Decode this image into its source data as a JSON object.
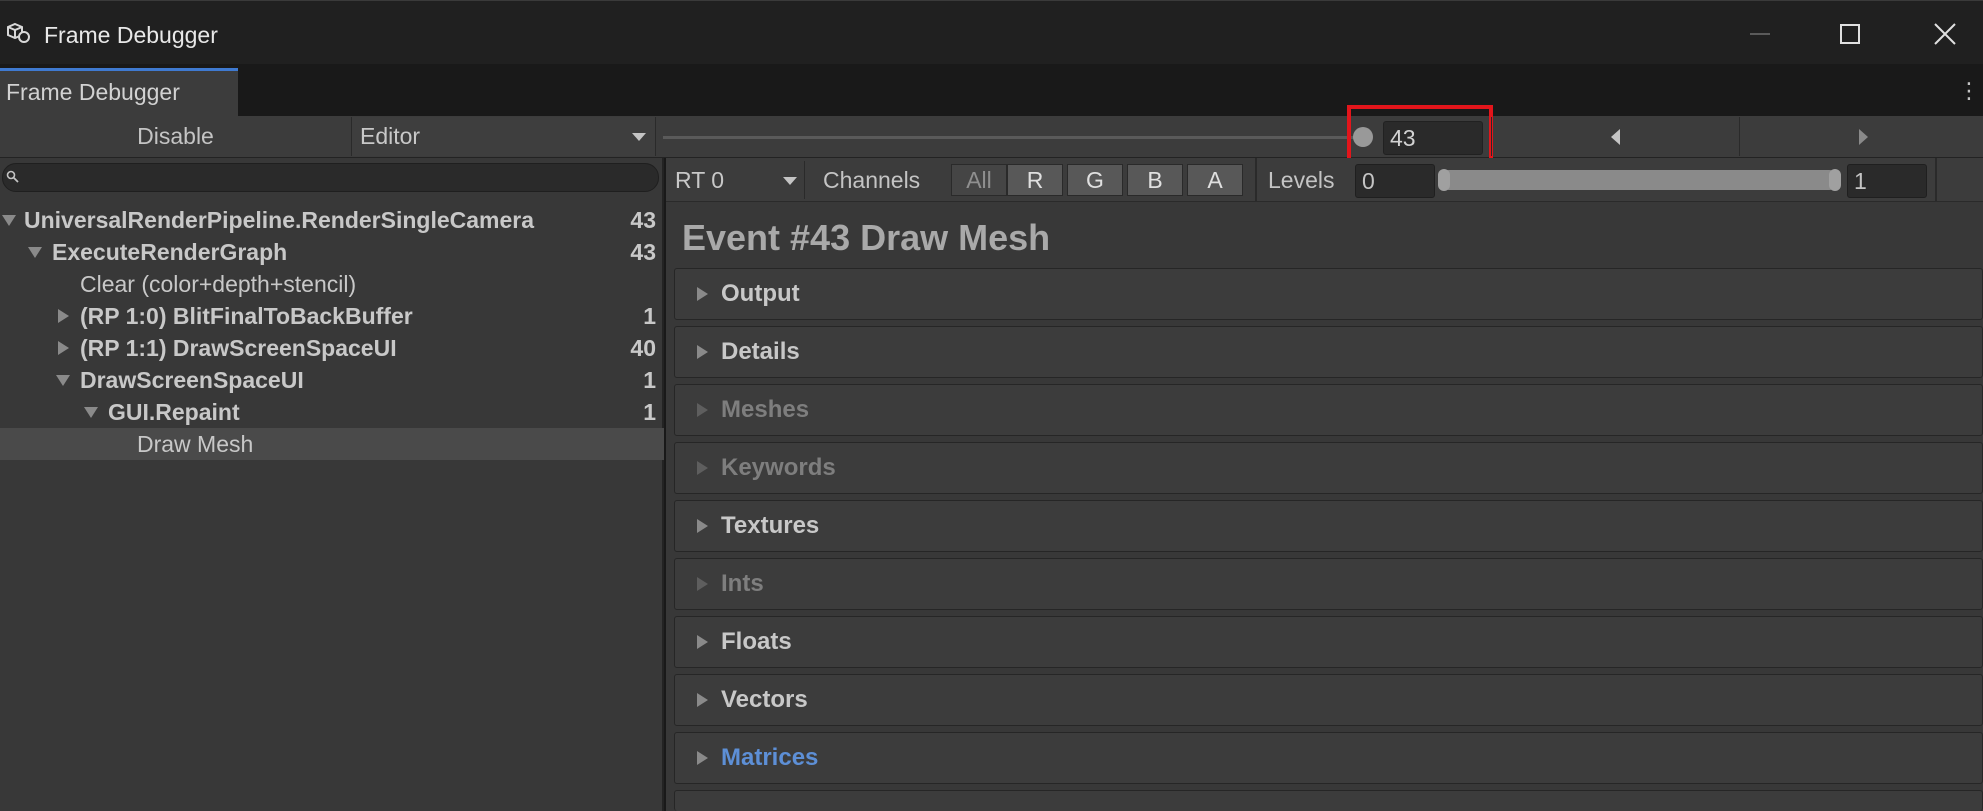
{
  "window": {
    "title": "Frame Debugger",
    "controls": [
      "minimize-icon",
      "maximize-icon",
      "close-icon"
    ]
  },
  "tab": {
    "label": "Frame Debugger"
  },
  "toolbar": {
    "disable_label": "Disable",
    "target_selected": "Editor",
    "event_index": "43",
    "prev_icon": "triangle-left-icon",
    "next_icon": "triangle-right-icon"
  },
  "search": {
    "placeholder": ""
  },
  "tree": [
    {
      "label": "UniversalRenderPipeline.RenderSingleCamera",
      "count": "43",
      "bold": true,
      "expanded": true
    },
    {
      "label": "ExecuteRenderGraph",
      "count": "43",
      "bold": true,
      "expanded": true
    },
    {
      "label": "Clear (color+depth+stencil)",
      "count": "",
      "bold": false
    },
    {
      "label": "(RP 1:0) BlitFinalToBackBuffer",
      "count": "1",
      "bold": true,
      "expanded": false
    },
    {
      "label": "(RP 1:1) DrawScreenSpaceUI",
      "count": "40",
      "bold": true,
      "expanded": false
    },
    {
      "label": "DrawScreenSpaceUI",
      "count": "1",
      "bold": true,
      "expanded": true
    },
    {
      "label": "GUI.Repaint",
      "count": "1",
      "bold": true,
      "expanded": true
    },
    {
      "label": "Draw Mesh",
      "count": "",
      "bold": false,
      "selected": true
    }
  ],
  "details": {
    "rt_selected": "RT 0",
    "channels_label": "Channels",
    "channels": [
      "All",
      "R",
      "G",
      "B",
      "A"
    ],
    "levels_label": "Levels",
    "levels_min": "0",
    "levels_max": "1",
    "event_title": "Event #43 Draw Mesh",
    "sections": [
      {
        "label": "Output",
        "state": "normal"
      },
      {
        "label": "Details",
        "state": "normal"
      },
      {
        "label": "Meshes",
        "state": "disabled"
      },
      {
        "label": "Keywords",
        "state": "disabled"
      },
      {
        "label": "Textures",
        "state": "normal"
      },
      {
        "label": "Ints",
        "state": "disabled"
      },
      {
        "label": "Floats",
        "state": "normal"
      },
      {
        "label": "Vectors",
        "state": "normal"
      },
      {
        "label": "Matrices",
        "state": "highlighted"
      }
    ]
  },
  "colors": {
    "highlight_box": "#e3151b",
    "tab_accent": "#3f7ad1",
    "matrices_text": "#5d8fd6"
  }
}
